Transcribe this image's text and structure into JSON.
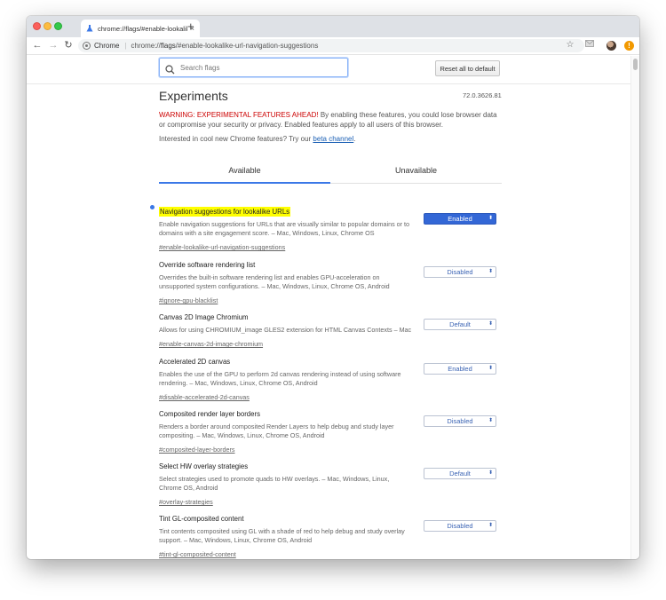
{
  "browser": {
    "tab_title": "chrome://flags/#enable-lookalike",
    "tab_close": "×",
    "new_tab": "+",
    "omnibox_chip": "Chrome",
    "omnibox_separator": "|",
    "url_scheme": "chrome://",
    "url_host": "flags",
    "url_path": "/#enable-lookalike-url-navigation-suggestions",
    "back": "←",
    "forward": "→",
    "reload": "↻",
    "star": "☆",
    "alert": "!"
  },
  "header": {
    "search_placeholder": "Search flags",
    "reset_label": "Reset all to default"
  },
  "page": {
    "title": "Experiments",
    "version": "72.0.3626.81",
    "warning_red": "WARNING: EXPERIMENTAL FEATURES AHEAD!",
    "warning_rest": " By enabling these features, you could lose browser data or compromise your security or privacy. Enabled features apply to all users of this browser.",
    "interested_text": "Interested in cool new Chrome features? Try our ",
    "beta_link": "beta channel",
    "interested_end": "."
  },
  "tabs": [
    "Available",
    "Unavailable"
  ],
  "experiments": [
    {
      "name": "Navigation suggestions for lookalike URLs",
      "desc": "Enable navigation suggestions for URLs that are visually similar to popular domains or to domains with a site engagement score. – Mac, Windows, Linux, Chrome OS",
      "link": "#enable-lookalike-url-navigation-suggestions",
      "value": "Enabled",
      "highlighted": true
    },
    {
      "name": "Override software rendering list",
      "desc": "Overrides the built-in software rendering list and enables GPU-acceleration on unsupported system configurations. – Mac, Windows, Linux, Chrome OS, Android",
      "link": "#ignore-gpu-blacklist",
      "value": "Disabled"
    },
    {
      "name": "Canvas 2D Image Chromium",
      "desc": "Allows for using CHROMIUM_image GLES2 extension for HTML Canvas Contexts – Mac",
      "link": "#enable-canvas-2d-image-chromium",
      "value": "Default"
    },
    {
      "name": "Accelerated 2D canvas",
      "desc": "Enables the use of the GPU to perform 2d canvas rendering instead of using software rendering. – Mac, Windows, Linux, Chrome OS, Android",
      "link": "#disable-accelerated-2d-canvas",
      "value": "Enabled"
    },
    {
      "name": "Composited render layer borders",
      "desc": "Renders a border around composited Render Layers to help debug and study layer compositing. – Mac, Windows, Linux, Chrome OS, Android",
      "link": "#composited-layer-borders",
      "value": "Disabled"
    },
    {
      "name": "Select HW overlay strategies",
      "desc": "Select strategies used to promote quads to HW overlays. – Mac, Windows, Linux, Chrome OS, Android",
      "link": "#overlay-strategies",
      "value": "Default"
    },
    {
      "name": "Tint GL-composited content",
      "desc": "Tint contents composited using GL with a shade of red to help debug and study overlay support. – Mac, Windows, Linux, Chrome OS, Android",
      "link": "#tint-gl-composited-content",
      "value": "Disabled"
    }
  ],
  "colors": {
    "accent": "#3367d6",
    "warning": "#cc0000",
    "highlight": "#ffff00"
  }
}
